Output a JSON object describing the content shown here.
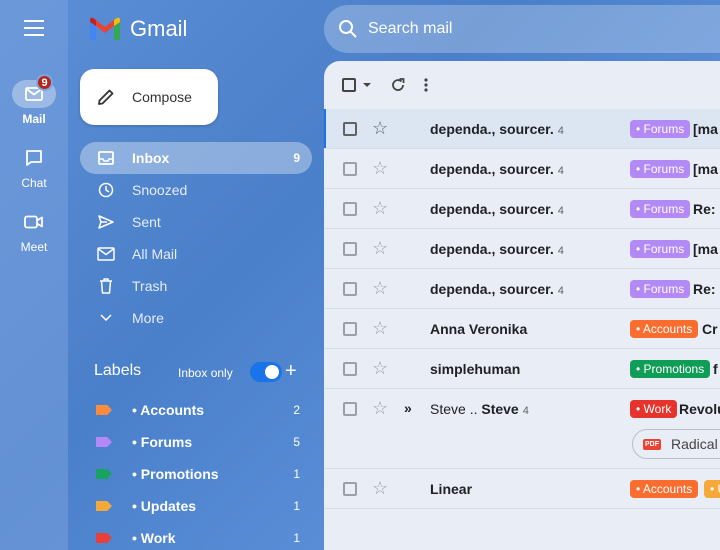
{
  "app": {
    "name": "Gmail"
  },
  "rail": {
    "items": [
      {
        "label": "Mail",
        "badge": "9"
      },
      {
        "label": "Chat"
      },
      {
        "label": "Meet"
      }
    ]
  },
  "compose": {
    "label": "Compose"
  },
  "nav": {
    "items": [
      {
        "label": "Inbox",
        "count": "9"
      },
      {
        "label": "Snoozed"
      },
      {
        "label": "Sent"
      },
      {
        "label": "All Mail"
      },
      {
        "label": "Trash"
      },
      {
        "label": "More"
      }
    ]
  },
  "labels": {
    "heading": "Labels",
    "inbox_only": "Inbox only",
    "items": [
      {
        "label": "• Accounts",
        "count": "2",
        "color": "#fb8c3f"
      },
      {
        "label": "• Forums",
        "count": "5",
        "color": "#b389f5"
      },
      {
        "label": "• Promotions",
        "count": "1",
        "color": "#1aa260"
      },
      {
        "label": "• Updates",
        "count": "1",
        "color": "#f6a93b"
      },
      {
        "label": "• Work",
        "count": "1",
        "color": "#e6403a"
      }
    ]
  },
  "search": {
    "placeholder": "Search mail"
  },
  "mails": [
    {
      "sender": "dependa., sourcer.",
      "count": "4",
      "tag": "• Forums",
      "subject": "[ma"
    },
    {
      "sender": "dependa., sourcer.",
      "count": "4",
      "tag": "• Forums",
      "subject": "[ma"
    },
    {
      "sender": "dependa., sourcer.",
      "count": "4",
      "tag": "• Forums",
      "subject": "Re: ["
    },
    {
      "sender": "dependa., sourcer.",
      "count": "4",
      "tag": "• Forums",
      "subject": "[ma"
    },
    {
      "sender": "dependa., sourcer.",
      "count": "4",
      "tag": "• Forums",
      "subject": "Re: ["
    },
    {
      "sender": "Anna Veronika",
      "tag": "• Accounts",
      "subject": "Cr"
    },
    {
      "sender": "simplehuman",
      "tag": "• Promotions",
      "subject": "f"
    },
    {
      "sender_a": "Steve .. ",
      "sender_b": "Steve",
      "count": "4",
      "tag": "• Work",
      "subject": "Revolu",
      "attachment": "Radical A",
      "pdf": "PDF"
    },
    {
      "sender": "Linear",
      "tag": "• Accounts",
      "tag2": "• U"
    }
  ]
}
